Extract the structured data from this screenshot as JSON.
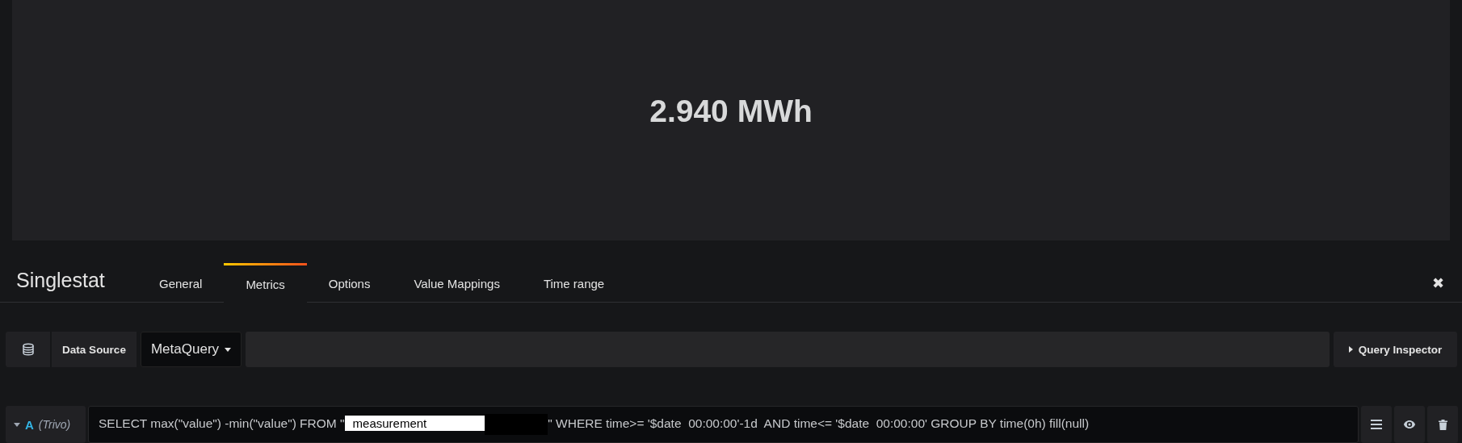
{
  "panel": {
    "value": "2.940 MWh"
  },
  "editor": {
    "title": "Singlestat",
    "tabs": [
      {
        "label": "General",
        "selected": false
      },
      {
        "label": "Metrics",
        "selected": true
      },
      {
        "label": "Options",
        "selected": false
      },
      {
        "label": "Value Mappings",
        "selected": false
      },
      {
        "label": "Time range",
        "selected": false
      }
    ],
    "close": "✖"
  },
  "datasource": {
    "label": "Data Source",
    "value": "MetaQuery",
    "inspector": "Query Inspector"
  },
  "query": {
    "letter": "A",
    "source": "(Trivo)",
    "collapsed": false,
    "prefix": "SELECT max(\"value\") -min(\"value\") FROM \"",
    "highlight": "measurement",
    "suffix": "\" WHERE time>= '$date  00:00:00'-1d  AND time<= '$date  00:00:00' GROUP BY time(0h) fill(null)"
  }
}
